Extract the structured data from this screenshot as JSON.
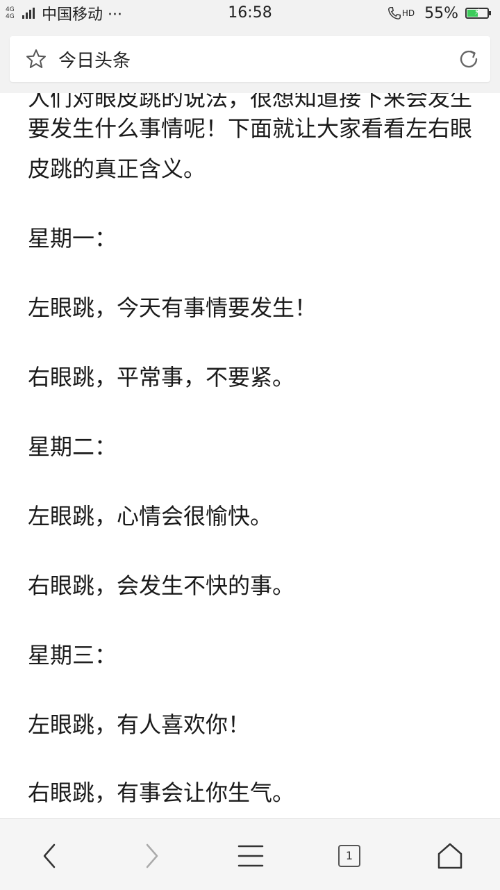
{
  "status_bar": {
    "network": "4G 4G",
    "carrier": "中国移动 ···",
    "time": "16:58",
    "hd": "HD",
    "battery_text": "55%",
    "battery_level": 0.55,
    "battery_color": "#3ccb5a"
  },
  "address_bar": {
    "title": "今日头条",
    "star_icon": "star-icon",
    "refresh_icon": "refresh-icon"
  },
  "article": {
    "cut_line": "人们对眼皮跳的说法，很想知道接下来会发生",
    "paragraphs": [
      "要发生什么事情呢！下面就让大家看看左右眼皮跳的真正含义。",
      "星期一：",
      "左眼跳，今天有事情要发生！",
      "右眼跳，平常事，不要紧。",
      "星期二：",
      "左眼跳，心情会很愉快。",
      "右眼跳，会发生不快的事。",
      "星期三：",
      "左眼跳，有人喜欢你！",
      "右眼跳，有事会让你生气。"
    ]
  },
  "bottom_nav": {
    "tabs_count": "1",
    "icons": [
      "back-icon",
      "forward-icon",
      "menu-icon",
      "tabs-icon",
      "home-icon"
    ]
  }
}
